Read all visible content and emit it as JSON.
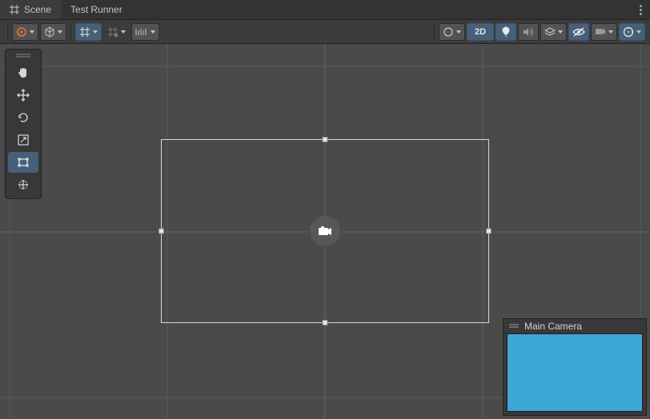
{
  "tabs": {
    "scene": "Scene",
    "testRunner": "Test Runner"
  },
  "toolbar": {
    "mode2d": "2D"
  },
  "preview": {
    "title": "Main Camera"
  },
  "colors": {
    "previewBg": "#3da7d6",
    "accentOrange": "#e27b39",
    "accentBlue": "#46607c"
  }
}
